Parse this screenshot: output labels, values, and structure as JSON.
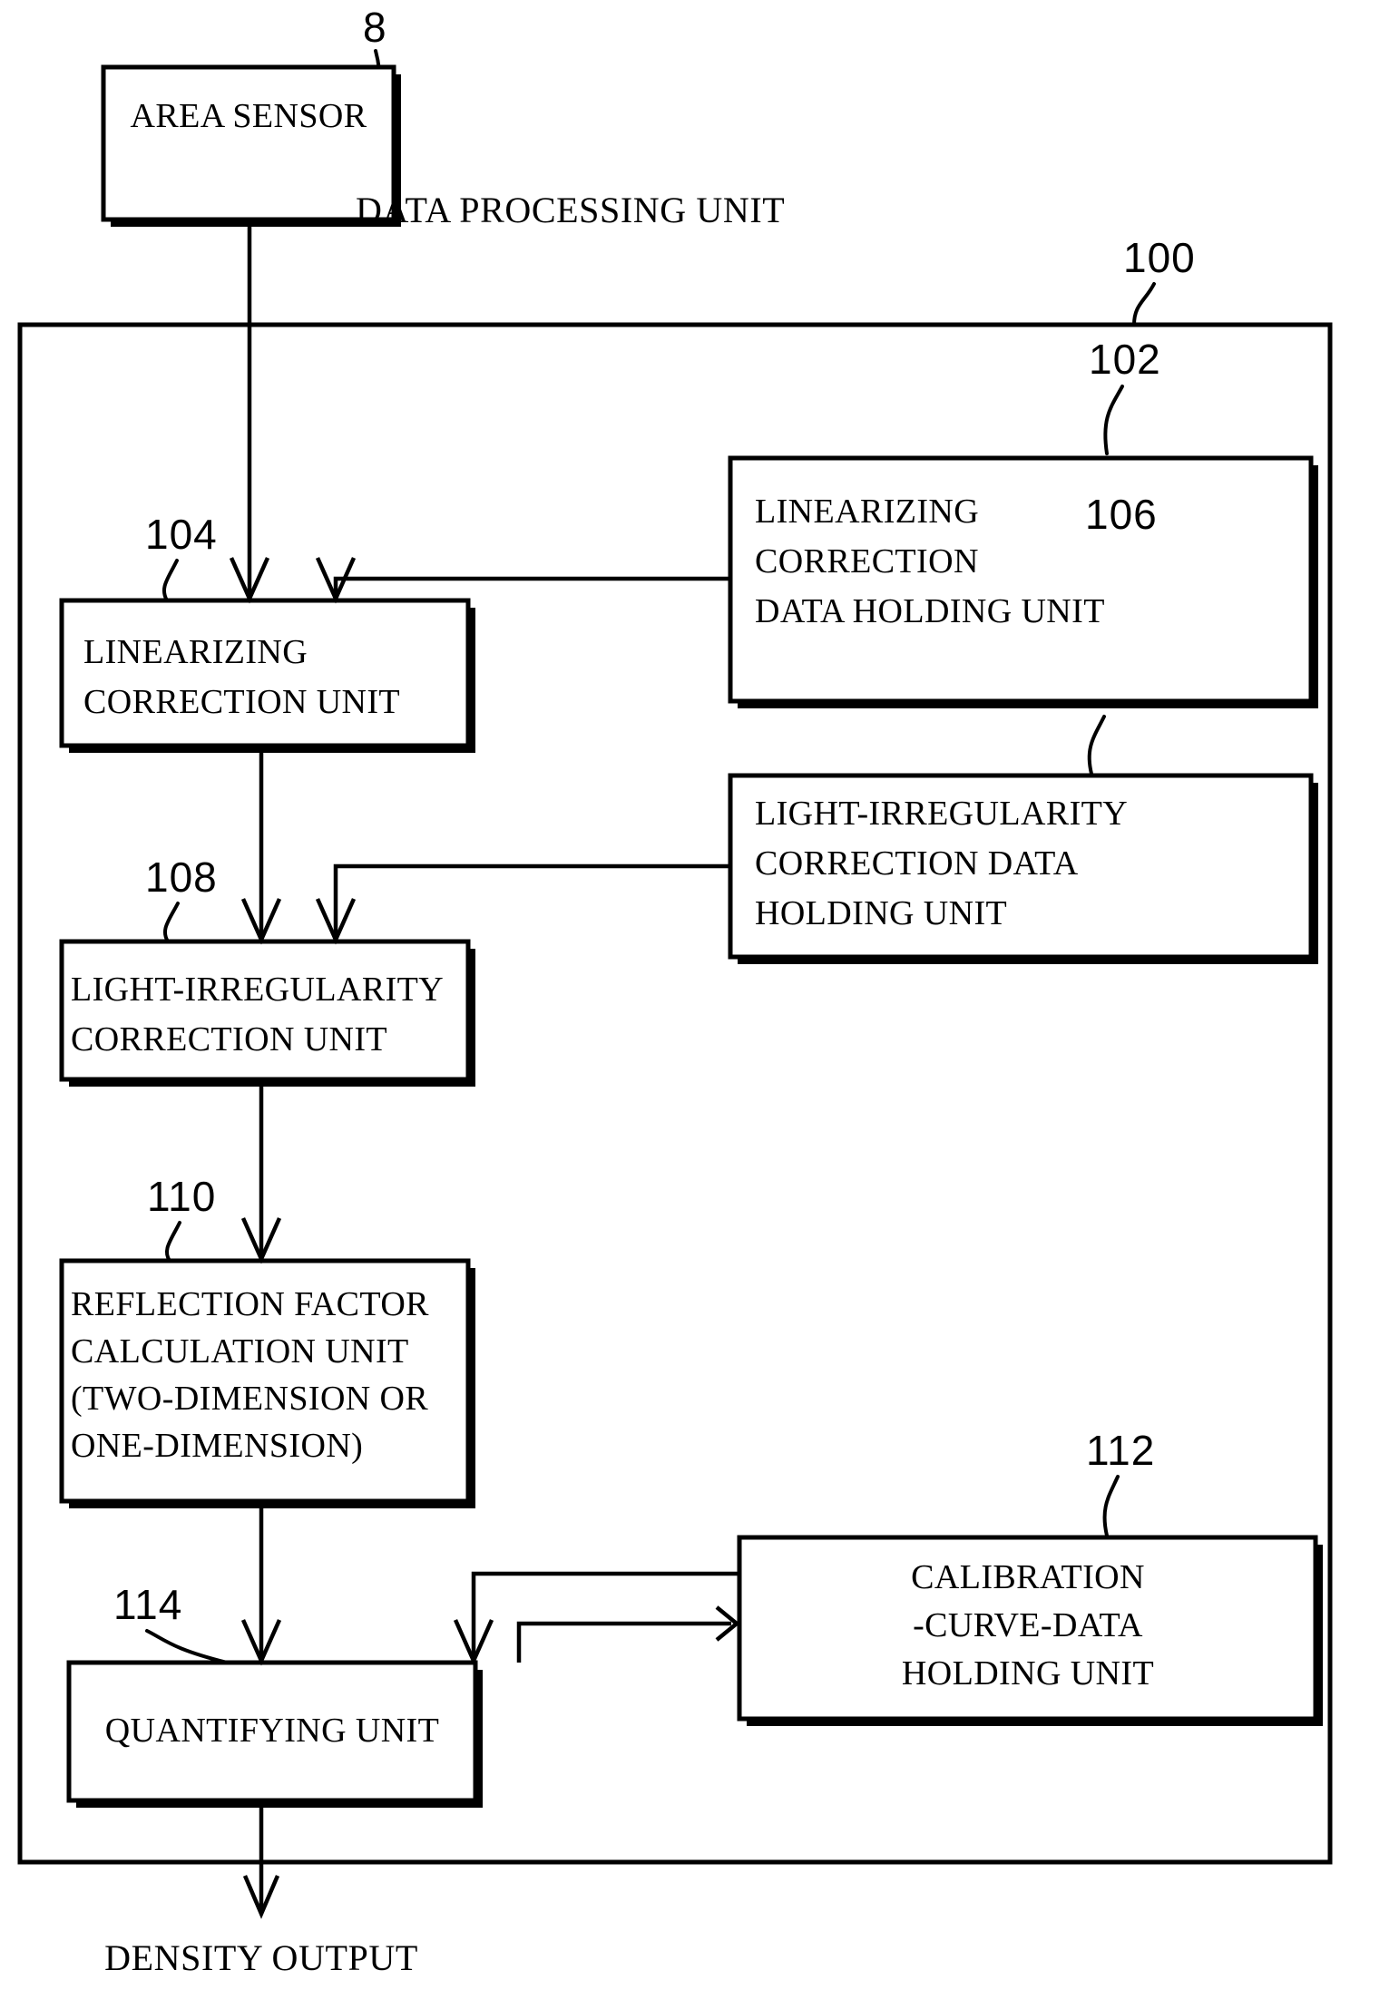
{
  "figure": {
    "title_label": "DATA PROCESSING UNIT",
    "output_label": "DENSITY OUTPUT",
    "ink_color": "#000000",
    "paper_color": "#ffffff"
  },
  "reference_numerals": {
    "area_sensor": "8",
    "data_processing_unit": "100",
    "linearizing_correction_data_holding_unit": "102",
    "linearizing_correction_unit": "104",
    "light_irregularity_correction_data_holding_unit": "106",
    "light_irregularity_correction_unit": "108",
    "reflection_factor_calculation_unit": "110",
    "calibration_curve_data_holding_unit": "112",
    "quantifying_unit": "114"
  },
  "blocks": {
    "area_sensor": {
      "ref": "8",
      "lines": [
        "AREA SENSOR"
      ],
      "align": "center"
    },
    "linearizing_correction_data_holding_unit": {
      "ref": "102",
      "lines": [
        "LINEARIZING",
        "CORRECTION",
        "DATA HOLDING UNIT"
      ],
      "align": "left"
    },
    "linearizing_correction_unit": {
      "ref": "104",
      "lines": [
        "LINEARIZING",
        "CORRECTION UNIT"
      ],
      "align": "left"
    },
    "light_irregularity_correction_data_holding_unit": {
      "ref": "106",
      "lines": [
        "LIGHT-IRREGULARITY",
        "CORRECTION DATA",
        "HOLDING UNIT"
      ],
      "align": "left"
    },
    "light_irregularity_correction_unit": {
      "ref": "108",
      "lines": [
        "LIGHT-IRREGULARITY",
        "CORRECTION UNIT"
      ],
      "align": "left"
    },
    "reflection_factor_calculation_unit": {
      "ref": "110",
      "lines": [
        "REFLECTION FACTOR",
        "CALCULATION UNIT",
        "(TWO-DIMENSION OR",
        "ONE-DIMENSION)"
      ],
      "align": "left"
    },
    "calibration_curve_data_holding_unit": {
      "ref": "112",
      "lines": [
        "CALIBRATION",
        "-CURVE-DATA",
        "HOLDING UNIT"
      ],
      "align": "center"
    },
    "quantifying_unit": {
      "ref": "114",
      "lines": [
        "QUANTIFYING UNIT"
      ],
      "align": "center"
    }
  },
  "chart_data": {
    "type": "diagram",
    "title": "DATA PROCESSING UNIT",
    "nodes": [
      {
        "id": "8",
        "label": "AREA SENSOR"
      },
      {
        "id": "100",
        "label": "DATA PROCESSING UNIT"
      },
      {
        "id": "102",
        "label": "LINEARIZING CORRECTION DATA HOLDING UNIT"
      },
      {
        "id": "104",
        "label": "LINEARIZING CORRECTION UNIT"
      },
      {
        "id": "106",
        "label": "LIGHT-IRREGULARITY CORRECTION DATA HOLDING UNIT"
      },
      {
        "id": "108",
        "label": "LIGHT-IRREGULARITY CORRECTION UNIT"
      },
      {
        "id": "110",
        "label": "REFLECTION FACTOR CALCULATION UNIT (TWO-DIMENSION OR ONE-DIMENSION)"
      },
      {
        "id": "112",
        "label": "CALIBRATION-CURVE-DATA HOLDING UNIT"
      },
      {
        "id": "114",
        "label": "QUANTIFYING UNIT"
      }
    ],
    "edges": [
      {
        "from": "8",
        "to": "104"
      },
      {
        "from": "102",
        "to": "104"
      },
      {
        "from": "104",
        "to": "108"
      },
      {
        "from": "106",
        "to": "108"
      },
      {
        "from": "108",
        "to": "110"
      },
      {
        "from": "110",
        "to": "114"
      },
      {
        "from": "112",
        "to": "114"
      },
      {
        "from": "114",
        "to": "112"
      },
      {
        "from": "114",
        "to": "DENSITY OUTPUT"
      }
    ]
  }
}
